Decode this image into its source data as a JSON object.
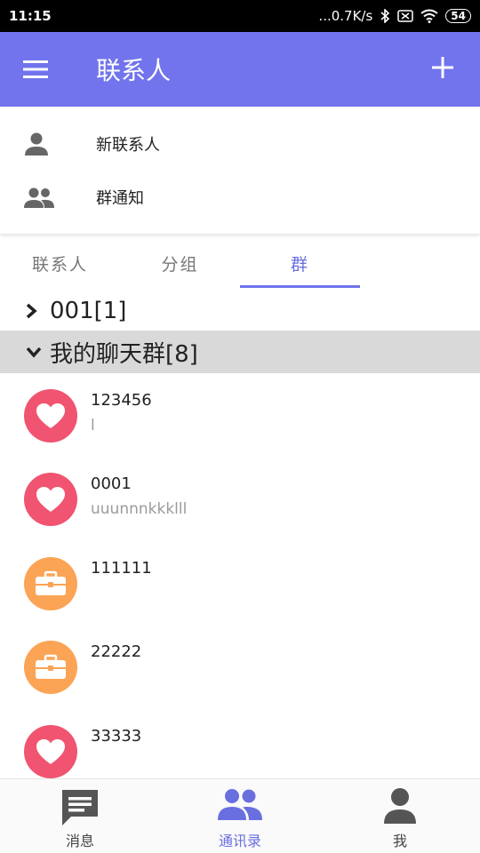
{
  "status_bar": {
    "time": "11:15",
    "network_speed": "...0.7K/s",
    "battery": "54"
  },
  "app_bar": {
    "title": "联系人",
    "menu_icon": "menu-icon",
    "add_icon": "plus-icon"
  },
  "quick_actions": [
    {
      "label": "新联系人",
      "icon": "person-icon"
    },
    {
      "label": "群通知",
      "icon": "people-icon"
    }
  ],
  "tabs": [
    {
      "label": "联系人",
      "active": false
    },
    {
      "label": "分组",
      "active": false
    },
    {
      "label": "群",
      "active": true
    }
  ],
  "groups": [
    {
      "label": "001[1]",
      "expanded": false
    },
    {
      "label": "我的聊天群[8]",
      "expanded": true
    }
  ],
  "members": [
    {
      "name": "123456",
      "sub": "l",
      "avatar": "heart-icon",
      "color": "#f15470"
    },
    {
      "name": "0001",
      "sub": "uuunnnkkklll",
      "avatar": "heart-icon",
      "color": "#f15470"
    },
    {
      "name": "111111",
      "sub": "",
      "avatar": "briefcase-icon",
      "color": "#fba455"
    },
    {
      "name": "22222",
      "sub": "",
      "avatar": "briefcase-icon",
      "color": "#fba455"
    },
    {
      "name": "33333",
      "sub": "",
      "avatar": "heart-icon",
      "color": "#f15470"
    }
  ],
  "bottom_nav": [
    {
      "label": "消息",
      "icon": "message-icon",
      "active": false
    },
    {
      "label": "通讯录",
      "icon": "contacts-icon",
      "active": true
    },
    {
      "label": "我",
      "icon": "profile-icon",
      "active": false
    }
  ],
  "colors": {
    "primary": "#7174ec",
    "accent_text": "#6a6fe0",
    "heart_avatar": "#f15470",
    "case_avatar": "#fba455",
    "group_expanded_bg": "#d9d9d9"
  }
}
